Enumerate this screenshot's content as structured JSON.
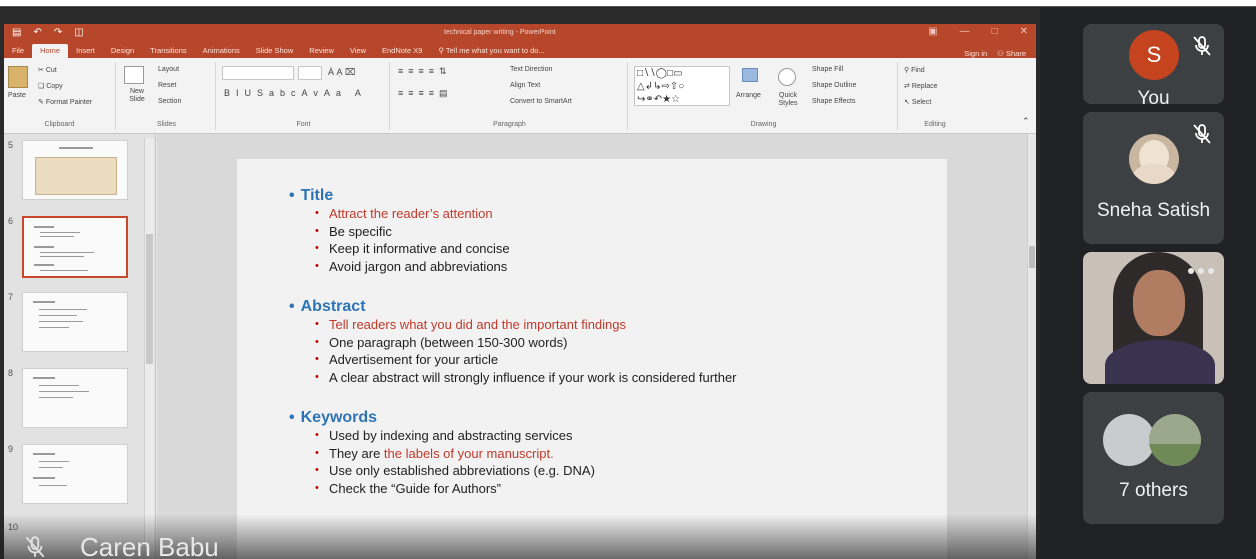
{
  "powerpoint": {
    "title": "technical paper writing - PowerPoint",
    "tabs": [
      "File",
      "Home",
      "Insert",
      "Design",
      "Transitions",
      "Animations",
      "Slide Show",
      "Review",
      "View",
      "EndNote X9"
    ],
    "tell_me": "Tell me what you want to do...",
    "sign_in": "Sign in",
    "share": "Share",
    "ribbon": {
      "clipboard": {
        "paste": "Paste",
        "cut": "Cut",
        "copy": "Copy",
        "format_painter": "Format Painter",
        "label": "Clipboard"
      },
      "slides": {
        "new_slide": "New Slide",
        "layout": "Layout",
        "reset": "Reset",
        "section": "Section",
        "label": "Slides"
      },
      "font": {
        "label": "Font"
      },
      "paragraph": {
        "text_direction": "Text Direction",
        "align_text": "Align Text",
        "convert": "Convert to SmartArt",
        "label": "Paragraph"
      },
      "drawing": {
        "arrange": "Arrange",
        "quick_styles": "Quick Styles",
        "shape_fill": "Shape Fill",
        "shape_outline": "Shape Outline",
        "shape_effects": "Shape Effects",
        "label": "Drawing"
      },
      "editing": {
        "find": "Find",
        "replace": "Replace",
        "select": "Select",
        "label": "Editing"
      }
    },
    "thumbnails": [
      {
        "num": "5"
      },
      {
        "num": "6"
      },
      {
        "num": "7"
      },
      {
        "num": "8"
      },
      {
        "num": "9"
      },
      {
        "num": "10"
      }
    ],
    "slide": {
      "sections": [
        {
          "heading": "Title",
          "bullets": [
            {
              "text": "Attract the reader’s attention"
            },
            {
              "text": "Be specific"
            },
            {
              "text": "Keep it informative and concise"
            },
            {
              "text": "Avoid jargon and abbreviations"
            }
          ]
        },
        {
          "heading": "Abstract",
          "bullets": [
            {
              "text": "Tell readers what you did and the important findings"
            },
            {
              "text": "One paragraph (between 150-300 words)"
            },
            {
              "text": "Advertisement for your article"
            },
            {
              "text": "A clear abstract will strongly influence if your work is considered further"
            }
          ]
        },
        {
          "heading": "Keywords",
          "bullets": [
            {
              "text": "Used by indexing and abstracting services"
            },
            {
              "text_a": "They are ",
              "text_b": "the labels of your manuscript."
            },
            {
              "text": "Use only established abbreviations (e.g. DNA)"
            },
            {
              "text": "Check the “Guide for Authors”"
            }
          ]
        }
      ]
    }
  },
  "presenter": {
    "name": "Caren Babu"
  },
  "participants": [
    {
      "initial": "S",
      "label": "You"
    },
    {
      "label": "Sneha Satish"
    },
    {
      "label": ""
    },
    {
      "label": "7 others"
    }
  ],
  "colors": {
    "ppt_accent": "#b7472a",
    "heading_blue": "#2e74b5",
    "highlight_red": "#c0392b",
    "tile_bg": "#3c4043",
    "avatar_orange": "#c5431f"
  }
}
